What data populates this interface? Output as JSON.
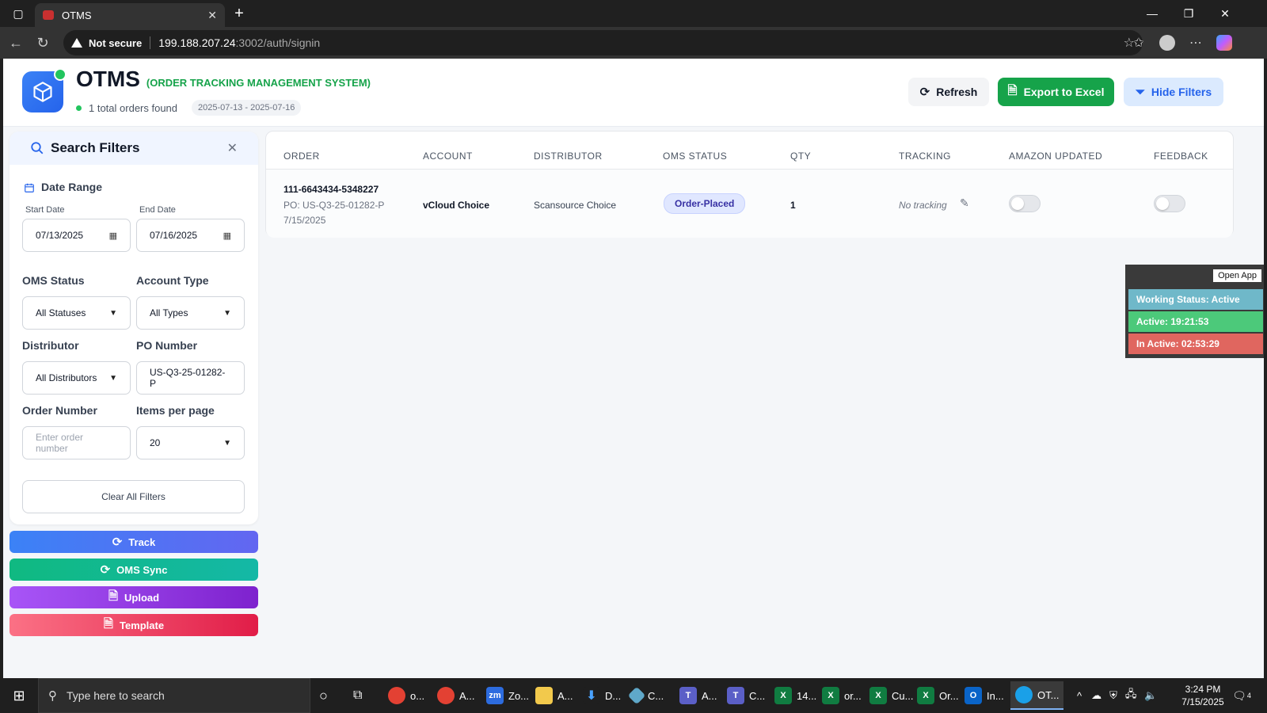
{
  "browser": {
    "tab_title": "OTMS",
    "security_label": "Not secure",
    "url_host": "199.188.207.24",
    "url_path": ":3002/auth/signin"
  },
  "header": {
    "app_name": "OTMS",
    "app_subtitle": "(ORDER TRACKING MANAGEMENT SYSTEM)",
    "orders_found": "1 total orders found",
    "date_range": "2025-07-13 - 2025-07-16",
    "refresh_label": "Refresh",
    "export_label": "Export to Excel",
    "hide_filters_label": "Hide Filters"
  },
  "filters": {
    "title": "Search Filters",
    "date_range_label": "Date Range",
    "start_date_label": "Start Date",
    "start_date_value": "07/13/2025",
    "end_date_label": "End Date",
    "end_date_value": "07/16/2025",
    "oms_status_label": "OMS Status",
    "oms_status_value": "All Statuses",
    "account_type_label": "Account Type",
    "account_type_value": "All Types",
    "distributor_label": "Distributor",
    "distributor_value": "All Distributors",
    "po_number_label": "PO Number",
    "po_number_value": "US-Q3-25-01282-P",
    "order_number_label": "Order Number",
    "order_number_placeholder": "Enter order number",
    "items_per_page_label": "Items per page",
    "items_per_page_value": "20",
    "clear_label": "Clear All Filters"
  },
  "actions": {
    "track": "Track",
    "oms_sync": "OMS Sync",
    "upload": "Upload",
    "template": "Template"
  },
  "table": {
    "columns": [
      "ORDER",
      "ACCOUNT",
      "DISTRIBUTOR",
      "OMS STATUS",
      "QTY",
      "TRACKING",
      "AMAZON UPDATED",
      "FEEDBACK"
    ],
    "rows": [
      {
        "order": "111-6643434-5348227",
        "po": "PO: US-Q3-25-01282-P",
        "date": "7/15/2025",
        "account": "vCloud Choice",
        "distributor": "Scansource Choice",
        "status": "Order-Placed",
        "qty": "1",
        "tracking": "No tracking",
        "amazon_updated": false,
        "feedback": false
      }
    ]
  },
  "widget": {
    "open_app": "Open App",
    "working_status": "Working Status: Active",
    "active": "Active: 19:21:53",
    "inactive": "In Active: 02:53:29"
  },
  "taskbar": {
    "search_placeholder": "Type here to search",
    "apps": [
      "o...",
      "A...",
      "Zo...",
      "A...",
      "D...",
      "C...",
      "A...",
      "C...",
      "14...",
      "or...",
      "Cu...",
      "Or...",
      "In...",
      "OT..."
    ],
    "time": "3:24 PM",
    "date": "7/15/2025",
    "notification_count": "4"
  }
}
